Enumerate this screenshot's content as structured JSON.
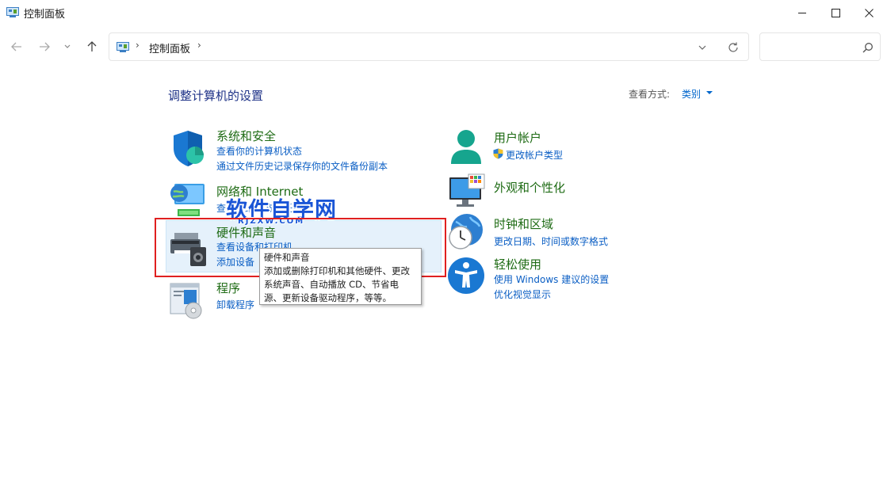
{
  "window": {
    "title": "控制面板",
    "minimize_icon": "minimize-icon",
    "maximize_icon": "maximize-icon",
    "close_icon": "close-icon"
  },
  "nav": {
    "back_icon": "arrow-left-icon",
    "forward_icon": "arrow-right-icon",
    "recent_icon": "chevron-down-icon",
    "up_icon": "arrow-up-icon"
  },
  "address": {
    "separator": "›",
    "crumb": "控制面板",
    "separator2": "›"
  },
  "search": {
    "placeholder": ""
  },
  "main": {
    "heading": "调整计算机的设置",
    "view_by_label": "查看方式:",
    "view_by_value": "类别"
  },
  "categories": {
    "system": {
      "title": "系统和安全",
      "links": [
        "查看你的计算机状态",
        "通过文件历史记录保存你的文件备份副本"
      ]
    },
    "network": {
      "title": "网络和 Internet",
      "links": [
        "查看网络状态和任务"
      ]
    },
    "hardware": {
      "title": "硬件和声音",
      "links": [
        "查看设备和打印机",
        "添加设备"
      ]
    },
    "programs": {
      "title": "程序",
      "links": [
        "卸载程序"
      ]
    },
    "accounts": {
      "title": "用户帐户",
      "links": [
        "更改帐户类型"
      ]
    },
    "appearance": {
      "title": "外观和个性化"
    },
    "clock": {
      "title": "时钟和区域",
      "links": [
        "更改日期、时间或数字格式"
      ]
    },
    "ease": {
      "title": "轻松使用",
      "links": [
        "使用 Windows 建议的设置",
        "优化视觉显示"
      ]
    }
  },
  "tooltip": {
    "lines": [
      "硬件和声音",
      "添加或删除打印机和其他硬件、更改",
      "系统声音、自动播放 CD、节省电",
      "源、更新设备驱动程序，等等。"
    ]
  },
  "watermark": {
    "text": "软件自学网",
    "sub": "RJZXW.COM"
  },
  "colors": {
    "category_title": "#1e6b14",
    "link": "#0a5ec4",
    "heading": "#1e3287",
    "highlight": "#e5f1fb",
    "annotation_box": "#e02020",
    "watermark": "#1a55d6"
  }
}
